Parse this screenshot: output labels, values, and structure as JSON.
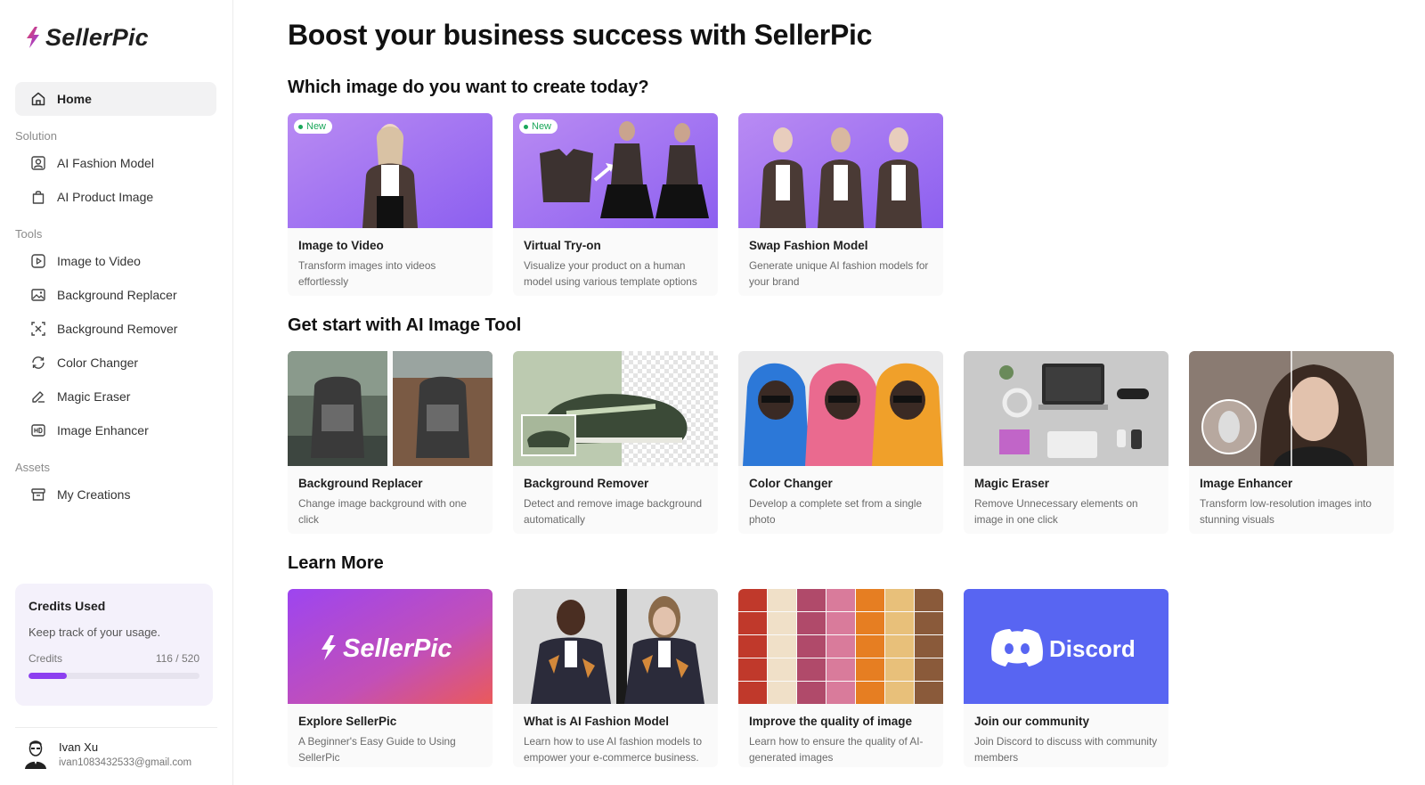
{
  "app": {
    "name": "SellerPic"
  },
  "sidebar": {
    "home_label": "Home",
    "sections": [
      {
        "label": "Solution",
        "items": [
          {
            "label": "AI Fashion Model",
            "icon": "portrait-icon"
          },
          {
            "label": "AI Product Image",
            "icon": "bag-icon"
          }
        ]
      },
      {
        "label": "Tools",
        "items": [
          {
            "label": "Image to Video",
            "icon": "play-square-icon"
          },
          {
            "label": "Background Replacer",
            "icon": "picture-icon"
          },
          {
            "label": "Background Remover",
            "icon": "remove-bg-icon"
          },
          {
            "label": "Color Changer",
            "icon": "color-cycle-icon"
          },
          {
            "label": "Magic Eraser",
            "icon": "eraser-icon"
          },
          {
            "label": "Image Enhancer",
            "icon": "hd-icon"
          }
        ]
      },
      {
        "label": "Assets",
        "items": [
          {
            "label": "My Creations",
            "icon": "archive-icon"
          }
        ]
      }
    ],
    "credits": {
      "title": "Credits Used",
      "description": "Keep track of your usage.",
      "label": "Credits",
      "value_text": "116 / 520",
      "used": 116,
      "total": 520
    },
    "user": {
      "name": "Ivan Xu",
      "email": "ivan1083432533@gmail.com"
    }
  },
  "main": {
    "title": "Boost your business success with SellerPic",
    "sections": [
      {
        "title": "Which image do you want to create today?",
        "cards": [
          {
            "title": "Image to Video",
            "desc": "Transform images into videos effortlessly",
            "badge": "New"
          },
          {
            "title": "Virtual Try-on",
            "desc": "Visualize your product on a human model using various template options",
            "badge": "New"
          },
          {
            "title": "Swap Fashion Model",
            "desc": "Generate unique AI fashion models for your brand",
            "badge": ""
          }
        ]
      },
      {
        "title": "Get start with AI Image Tool",
        "cards": [
          {
            "title": "Background Replacer",
            "desc": "Change image background with one click"
          },
          {
            "title": "Background Remover",
            "desc": "Detect and remove image background automatically"
          },
          {
            "title": "Color Changer",
            "desc": "Develop a complete set from a single photo"
          },
          {
            "title": "Magic Eraser",
            "desc": "Remove Unnecessary elements on image in one click"
          },
          {
            "title": "Image Enhancer",
            "desc": "Transform low-resolution images into stunning visuals"
          }
        ]
      },
      {
        "title": "Learn More",
        "cards": [
          {
            "title": "Explore SellerPic",
            "desc": "A Beginner's Easy Guide to Using SellerPic",
            "banner_text": "SellerPic"
          },
          {
            "title": "What is AI Fashion Model",
            "desc": "Learn how to use AI fashion models to empower your e-commerce business."
          },
          {
            "title": "Improve the quality of image",
            "desc": "Learn how to ensure the quality of AI-generated images"
          },
          {
            "title": "Join our community",
            "desc": "Join Discord to discuss with community members",
            "banner_text": "Discord"
          }
        ]
      }
    ]
  },
  "colors": {
    "accent": "#8c3ff0",
    "discord": "#5865f2",
    "new_badge": "#1aa75a"
  }
}
